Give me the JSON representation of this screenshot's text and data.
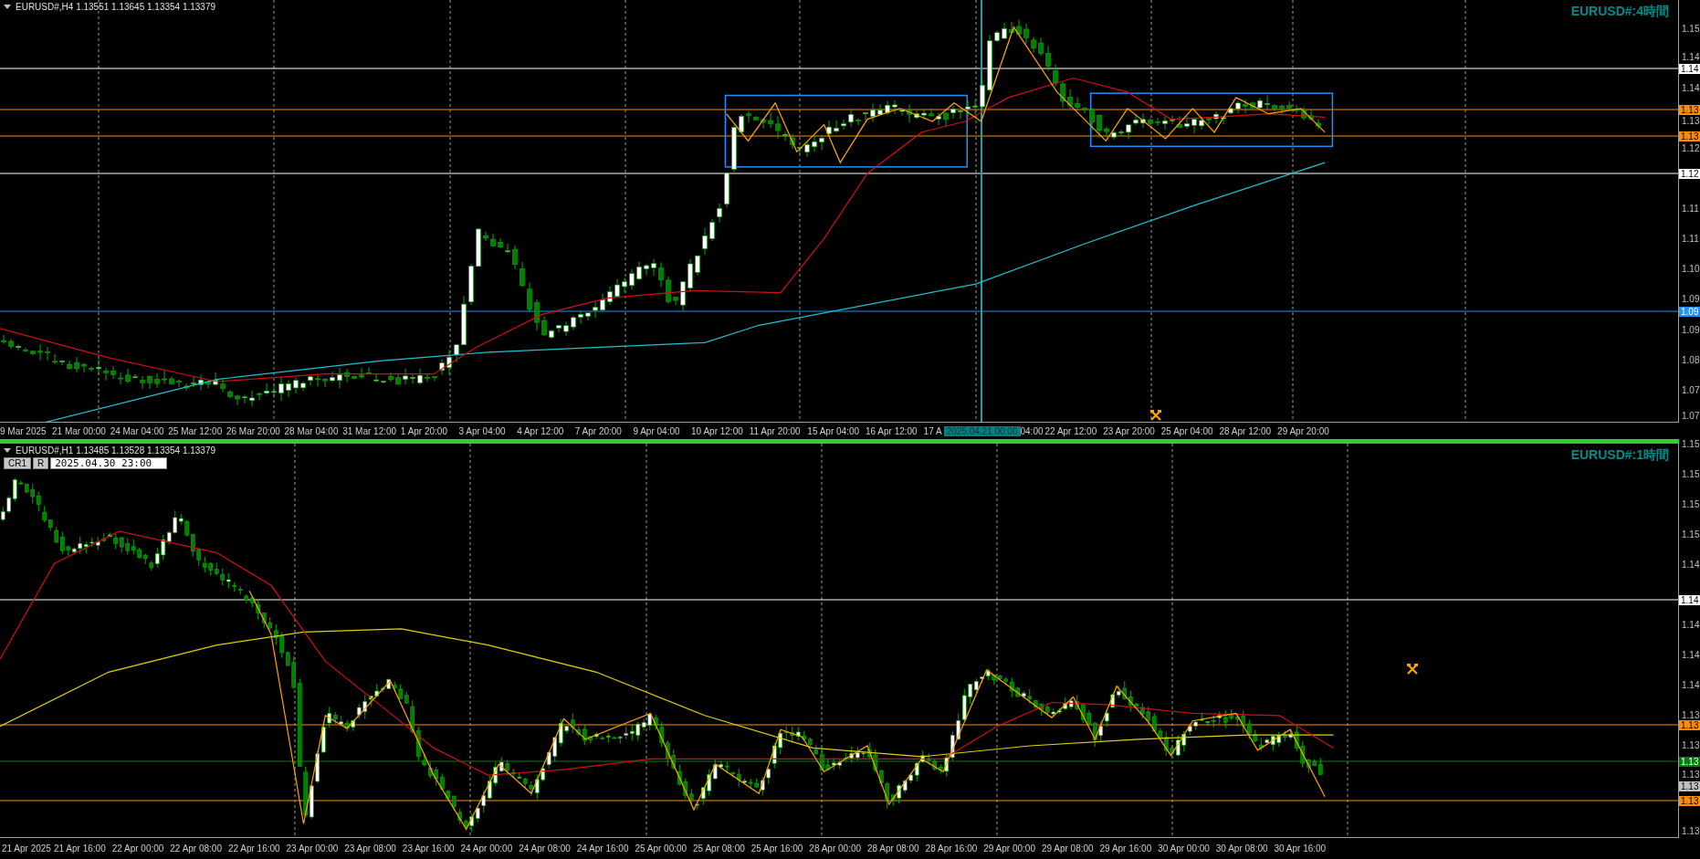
{
  "panels": [
    {
      "symbol_info": "EURUSD#,H4  1.13551 1.13645 1.13354 1.13379",
      "timeframe_label": "EURUSD#:4時間",
      "price_ticks": [
        "1.15",
        "1.14",
        "1.14",
        "1.13",
        "1.12",
        "1.11",
        "1.11",
        "1.10",
        "1.09",
        "1.09",
        "1.08",
        "1.07",
        "1.07"
      ],
      "price_tags": [
        {
          "text": "1.14",
          "color": "#ffffff",
          "line": true
        },
        {
          "text": "1.13",
          "color": "#ff8c00",
          "line": true
        },
        {
          "text": "1.13",
          "color": "#ff8c00",
          "line": true
        },
        {
          "text": "1.12",
          "color": "#ffffff",
          "line": true
        },
        {
          "text": "1.09",
          "color": "#1e90ff",
          "line": true
        }
      ],
      "time_labels": [
        {
          "kind": "first",
          "text": "9 Mar 2025"
        },
        {
          "kind": "label",
          "text": "21 Mar 00:00"
        },
        {
          "kind": "label",
          "text": "24 Mar 04:00"
        },
        {
          "kind": "label",
          "text": "25 Mar 12:00"
        },
        {
          "kind": "label",
          "text": "26 Mar 20:00"
        },
        {
          "kind": "label",
          "text": "28 Mar 04:00"
        },
        {
          "kind": "label",
          "text": "31 Mar 12:00"
        },
        {
          "kind": "label",
          "text": "1 Apr 20:00"
        },
        {
          "kind": "label",
          "text": "3 Apr 04:00"
        },
        {
          "kind": "label",
          "text": "4 Apr 12:00"
        },
        {
          "kind": "label",
          "text": "7 Apr 20:00"
        },
        {
          "kind": "label",
          "text": "9 Apr 04:00"
        },
        {
          "kind": "label",
          "text": "10 Apr 12:00"
        },
        {
          "kind": "label",
          "text": "11 Apr 20:00"
        },
        {
          "kind": "label",
          "text": "15 Apr 04:00"
        },
        {
          "kind": "label",
          "text": "16 Apr 12:00"
        },
        {
          "kind": "partial",
          "text": "17 A"
        },
        {
          "kind": "highlight",
          "text": "2025.04.21 00:00"
        },
        {
          "kind": "partial",
          "text": "04:00"
        },
        {
          "kind": "label",
          "text": "22 Apr 12:00"
        },
        {
          "kind": "label",
          "text": "23 Apr 20:00"
        },
        {
          "kind": "label",
          "text": "25 Apr 04:00"
        },
        {
          "kind": "label",
          "text": "28 Apr 12:00"
        },
        {
          "kind": "label",
          "text": "29 Apr 20:00"
        }
      ]
    },
    {
      "symbol_info": "EURUSD#,H1  1.13485 1.13528 1.13354 1.13379",
      "timeframe_label": "EURUSD#:1時間",
      "active": true,
      "buttons": [
        "CR1",
        "R"
      ],
      "date_field": "2025.04.30 23:00",
      "price_ticks": [
        "1.15",
        "1.15",
        "1.15",
        "1.15",
        "1.14",
        "1.14",
        "1.14",
        "1.14",
        "1.13",
        "1.13",
        "1.13",
        "1.13"
      ],
      "price_tags": [
        {
          "text": "1.14",
          "color": "#ffffff",
          "line": true
        },
        {
          "text": "1.13",
          "color": "#ff8c00",
          "line": true
        },
        {
          "text": "1.13",
          "color": "#008000",
          "line": true
        },
        {
          "text": "1.13",
          "color": "#c0c0c0",
          "line": false
        },
        {
          "text": "1.13",
          "color": "#ff8c00",
          "line": true
        }
      ],
      "time_labels": [
        {
          "kind": "first",
          "text": "21 Apr 2025"
        },
        {
          "kind": "label",
          "text": "21 Apr 16:00"
        },
        {
          "kind": "label",
          "text": "22 Apr 00:00"
        },
        {
          "kind": "label",
          "text": "22 Apr 08:00"
        },
        {
          "kind": "label",
          "text": "22 Apr 16:00"
        },
        {
          "kind": "label",
          "text": "23 Apr 00:00"
        },
        {
          "kind": "label",
          "text": "23 Apr 08:00"
        },
        {
          "kind": "label",
          "text": "23 Apr 16:00"
        },
        {
          "kind": "label",
          "text": "24 Apr 00:00"
        },
        {
          "kind": "label",
          "text": "24 Apr 08:00"
        },
        {
          "kind": "label",
          "text": "24 Apr 16:00"
        },
        {
          "kind": "label",
          "text": "25 Apr 00:00"
        },
        {
          "kind": "label",
          "text": "25 Apr 08:00"
        },
        {
          "kind": "label",
          "text": "25 Apr 16:00"
        },
        {
          "kind": "label",
          "text": "28 Apr 00:00"
        },
        {
          "kind": "label",
          "text": "28 Apr 08:00"
        },
        {
          "kind": "label",
          "text": "28 Apr 16:00"
        },
        {
          "kind": "label",
          "text": "29 Apr 00:00"
        },
        {
          "kind": "label",
          "text": "29 Apr 08:00"
        },
        {
          "kind": "label",
          "text": "29 Apr 16:00"
        },
        {
          "kind": "label",
          "text": "30 Apr 00:00"
        },
        {
          "kind": "label",
          "text": "30 Apr 08:00"
        },
        {
          "kind": "label",
          "text": "30 Apr 16:00"
        }
      ]
    }
  ]
}
